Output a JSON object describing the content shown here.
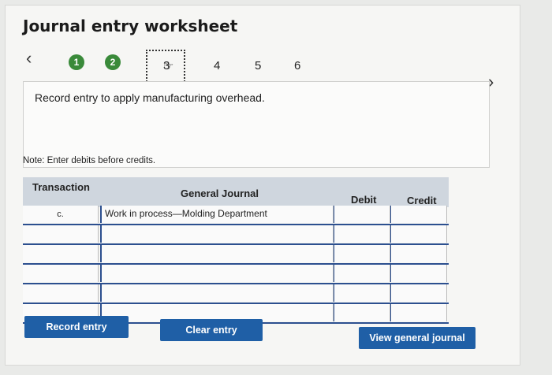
{
  "title": "Journal entry worksheet",
  "steps": [
    "1",
    "2",
    "3",
    "4",
    "5",
    "6"
  ],
  "description": "Record entry to apply manufacturing overhead.",
  "note": "Note: Enter debits before credits.",
  "table": {
    "headers": {
      "transaction": "Transaction",
      "general_journal": "General Journal",
      "debit": "Debit",
      "credit": "Credit"
    },
    "rows": [
      {
        "transaction": "c.",
        "account": "Work in process—Molding Department",
        "debit": "",
        "credit": ""
      },
      {
        "transaction": "",
        "account": "",
        "debit": "",
        "credit": ""
      },
      {
        "transaction": "",
        "account": "",
        "debit": "",
        "credit": ""
      },
      {
        "transaction": "",
        "account": "",
        "debit": "",
        "credit": ""
      },
      {
        "transaction": "",
        "account": "",
        "debit": "",
        "credit": ""
      },
      {
        "transaction": "",
        "account": "",
        "debit": "",
        "credit": ""
      }
    ]
  },
  "buttons": {
    "record": "Record entry",
    "clear": "Clear entry",
    "view": "View general journal"
  },
  "colors": {
    "step_done": "#3a8a3a",
    "button": "#1f5fa6",
    "table_line": "#2c4f8f",
    "header_bg": "#cfd6de"
  },
  "icons": {
    "prev": "chevron-left-icon",
    "next": "chevron-right-icon",
    "cursor": "hand-pointer-icon"
  }
}
